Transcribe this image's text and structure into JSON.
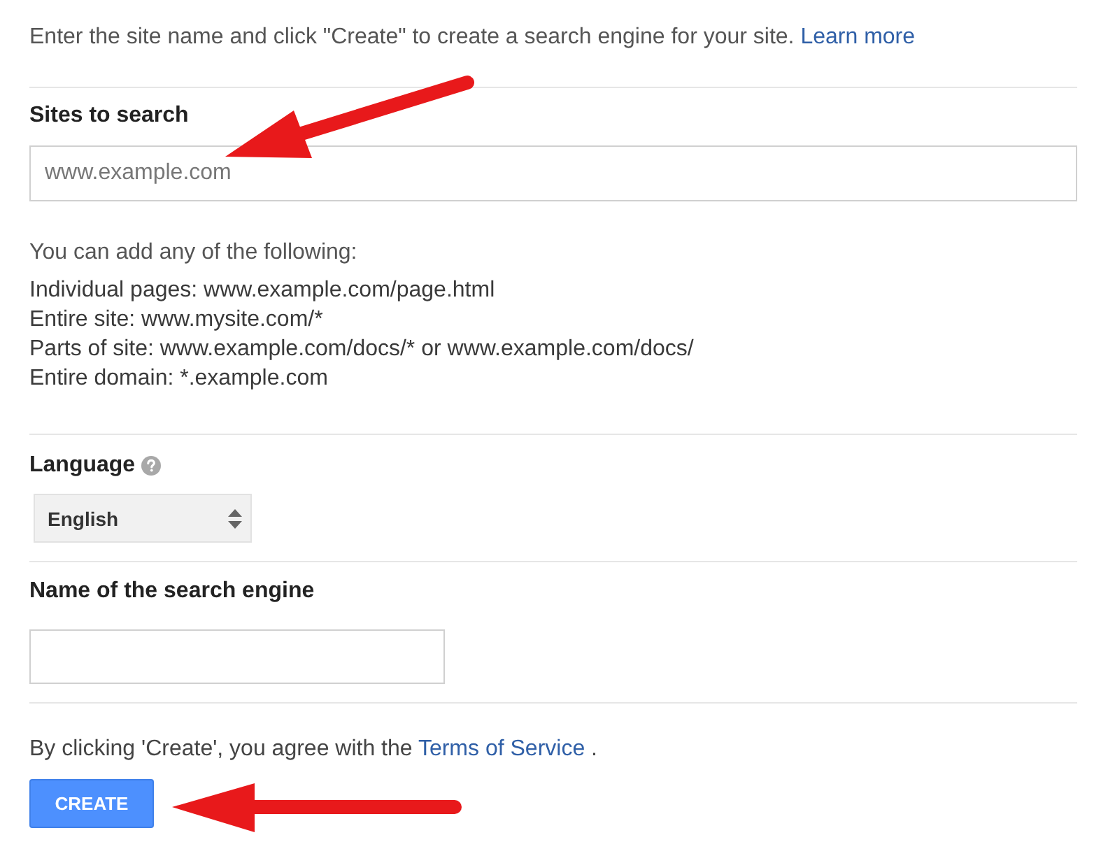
{
  "intro": {
    "text": "Enter the site name and click \"Create\" to create a search engine for your site.",
    "link": "Learn more"
  },
  "sites_field": {
    "label": "Sites to search",
    "placeholder": "www.example.com"
  },
  "hint": {
    "heading": "You can add any of the following:",
    "lines": [
      "Individual pages: www.example.com/page.html",
      "Entire site: www.mysite.com/*",
      "Parts of site: www.example.com/docs/* or www.example.com/docs/",
      "Entire domain: *.example.com"
    ]
  },
  "language": {
    "label": "Language",
    "value": "English"
  },
  "name_field": {
    "label": "Name of the search engine"
  },
  "terms": {
    "text": "By clicking 'Create', you agree with the",
    "link": "Terms of Service",
    "end": "."
  },
  "button": {
    "label": "CREATE"
  }
}
